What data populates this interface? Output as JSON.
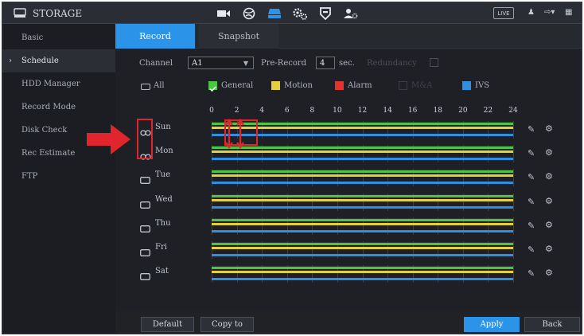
{
  "header": {
    "title": "STORAGE",
    "live_label": "LIVE",
    "nav_icons": [
      "camera-icon",
      "network-icon",
      "storage-icon",
      "settings-icon",
      "shield-icon",
      "account-icon"
    ]
  },
  "sidebar": {
    "items": [
      {
        "label": "Basic"
      },
      {
        "label": "Schedule"
      },
      {
        "label": "HDD Manager"
      },
      {
        "label": "Record Mode"
      },
      {
        "label": "Disk Check"
      },
      {
        "label": "Rec Estimate"
      },
      {
        "label": "FTP"
      }
    ],
    "active_index": 1
  },
  "tabs": [
    {
      "label": "Record"
    },
    {
      "label": "Snapshot"
    }
  ],
  "controls": {
    "channel_label": "Channel",
    "channel_value": "A1",
    "prerecord_label": "Pre-Record",
    "prerecord_value": "4",
    "prerecord_unit": "sec.",
    "redundancy_label": "Redundancy"
  },
  "legend": {
    "all_label": "All",
    "items": [
      {
        "label": "General",
        "color": "#4cc444"
      },
      {
        "label": "Motion",
        "color": "#e5cf3f"
      },
      {
        "label": "Alarm",
        "color": "#e5322c"
      },
      {
        "label": "M&A",
        "color": "#3a3d44"
      },
      {
        "label": "IVS",
        "color": "#2f8fe0"
      }
    ]
  },
  "timeline": {
    "ticks": [
      "0",
      "2",
      "4",
      "6",
      "8",
      "10",
      "12",
      "14",
      "16",
      "18",
      "20",
      "22",
      "24"
    ]
  },
  "days": [
    {
      "label": "Sun"
    },
    {
      "label": "Mon"
    },
    {
      "label": "Tue"
    },
    {
      "label": "Wed"
    },
    {
      "label": "Thu"
    },
    {
      "label": "Fri"
    },
    {
      "label": "Sat"
    }
  ],
  "footer": {
    "default_label": "Default",
    "copy_label": "Copy to",
    "apply_label": "Apply",
    "back_label": "Back"
  }
}
